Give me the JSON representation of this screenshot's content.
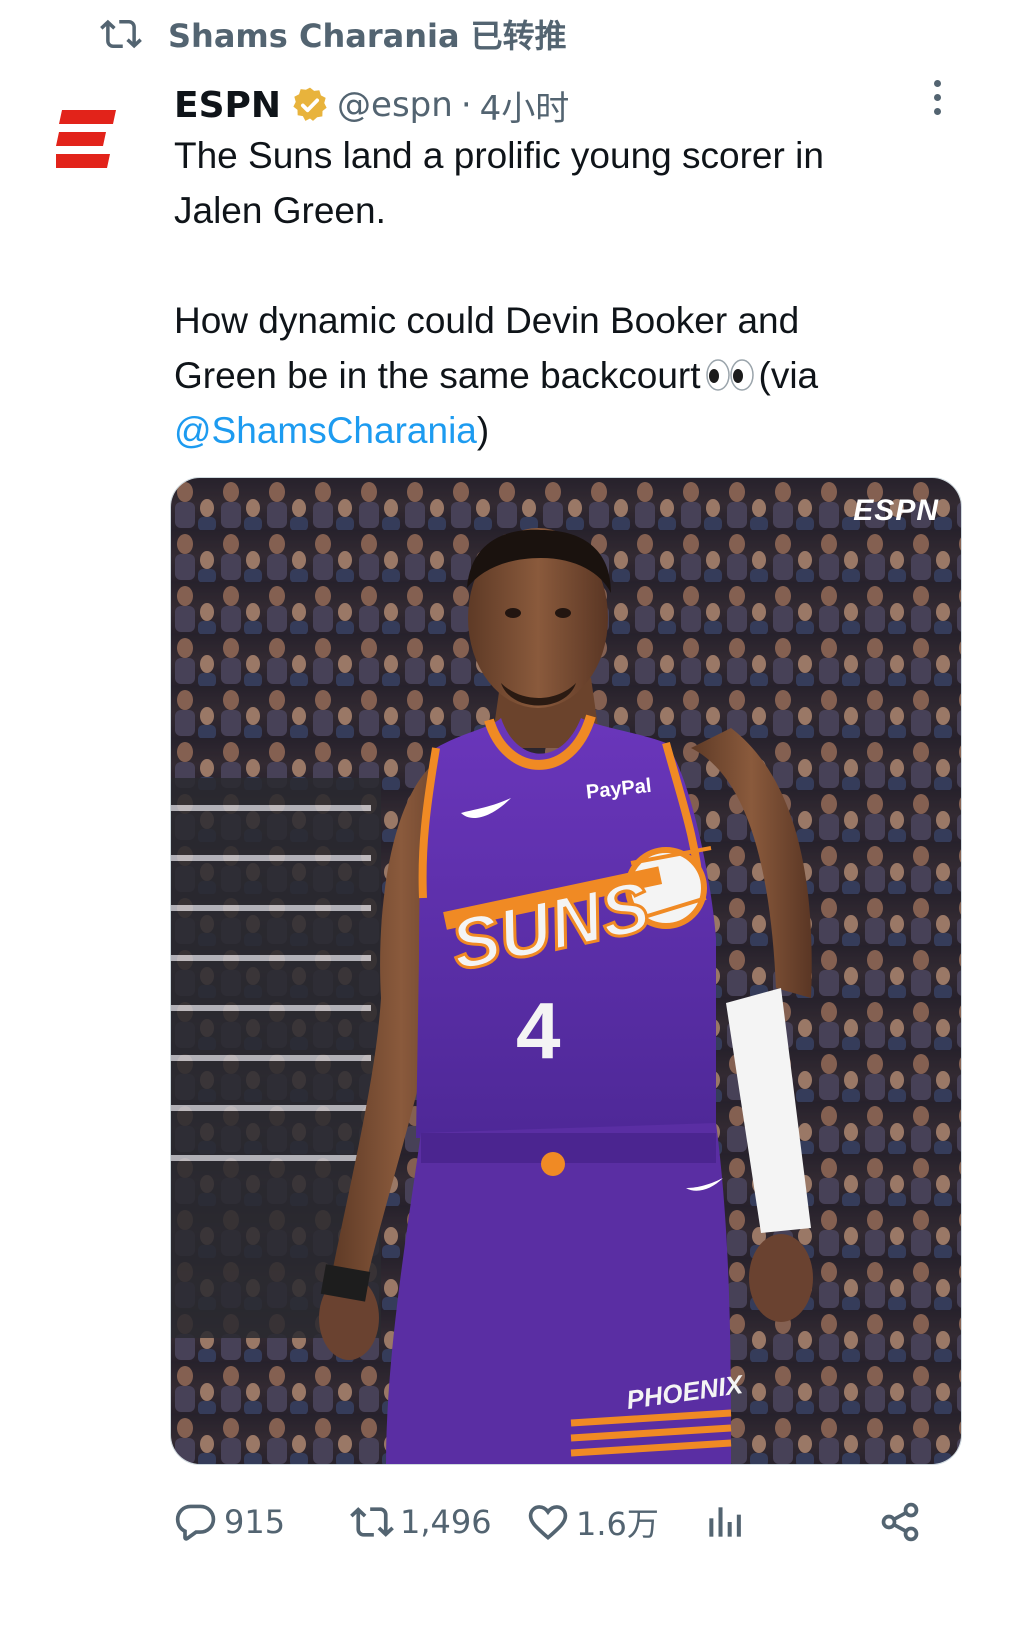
{
  "retweet_header": {
    "label": "Shams Charania 已转推",
    "icon": "retweet-icon"
  },
  "tweet": {
    "author_name": "ESPN",
    "verified_badge": "verified-gold-badge-icon",
    "handle": "@espn",
    "separator": "·",
    "timestamp": "4小时",
    "text": {
      "line1": "The Suns land a prolific young scorer in",
      "line2": "Jalen Green.",
      "line3": "How dynamic could Devin Booker and",
      "line4_start": "Green be in the same backcourt",
      "line4_end": "(via",
      "mention": "@ShamsCharania",
      "close_paren": ")"
    },
    "media": {
      "watermark": "ESPN",
      "jersey_text": "SUNS",
      "jersey_number": "4",
      "sponsor": "PayPal",
      "shorts_text": "PHOENIX"
    }
  },
  "actions": {
    "reply_count": "915",
    "retweet_count": "1,496",
    "like_count": "1.6万",
    "views_icon": "bar-chart-icon",
    "share_icon": "share-icon"
  },
  "colors": {
    "accent": "#1d9bf0",
    "secondary_text": "#536471",
    "espn_red": "#e2231a",
    "verified_gold": "#e8b33c",
    "suns_purple": "#5b2ea6",
    "suns_orange": "#f08a24"
  }
}
